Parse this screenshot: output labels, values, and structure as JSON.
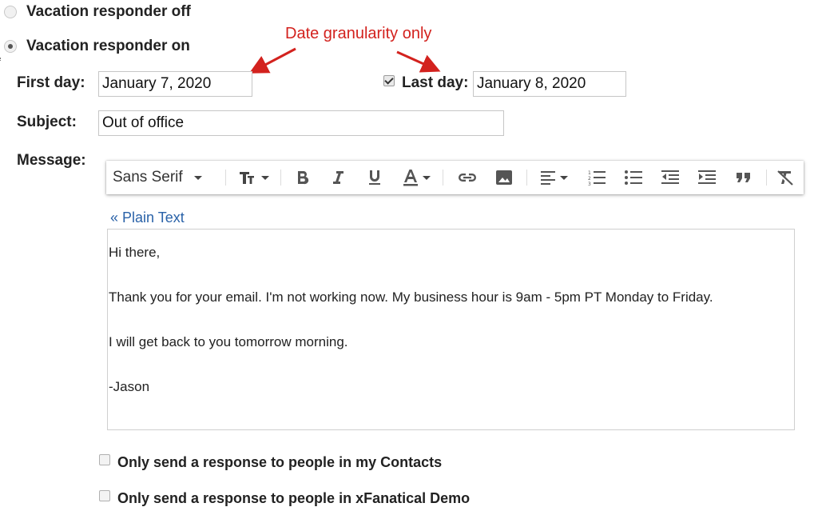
{
  "responder": {
    "off_label": "Vacation responder off",
    "on_label": "Vacation responder on",
    "selected": "on"
  },
  "annotation": {
    "text": "Date granularity only",
    "color": "#d3221e"
  },
  "dates": {
    "first_day_label": "First day:",
    "first_day_value": "January 7, 2020",
    "last_day_label": "Last day:",
    "last_day_value": "January 8, 2020",
    "last_day_enabled": true
  },
  "subject": {
    "label": "Subject:",
    "value": "Out of office"
  },
  "message": {
    "label": "Message:",
    "toolbar": {
      "font": "Sans Serif",
      "buttons": [
        "font-size",
        "bold",
        "italic",
        "underline",
        "text-color",
        "link",
        "image",
        "align",
        "numbered-list",
        "bulleted-list",
        "indent-less",
        "indent-more",
        "quote",
        "remove-formatting"
      ]
    },
    "plain_text_link": "« Plain Text",
    "body": {
      "line1": "Hi there,",
      "line2": "Thank you for your email. I'm not working now. My business hour is 9am - 5pm PT Monday to Friday.",
      "line3": "I will get back to you tomorrow morning.",
      "line4": "-Jason"
    }
  },
  "options": {
    "contacts_only": {
      "label": "Only send a response to people in my Contacts",
      "checked": false
    },
    "org_only": {
      "label": "Only send a response to people in xFanatical Demo",
      "checked": false
    }
  },
  "colors": {
    "link": "#2a62a8",
    "annotation": "#d3221e",
    "text": "#222222"
  }
}
